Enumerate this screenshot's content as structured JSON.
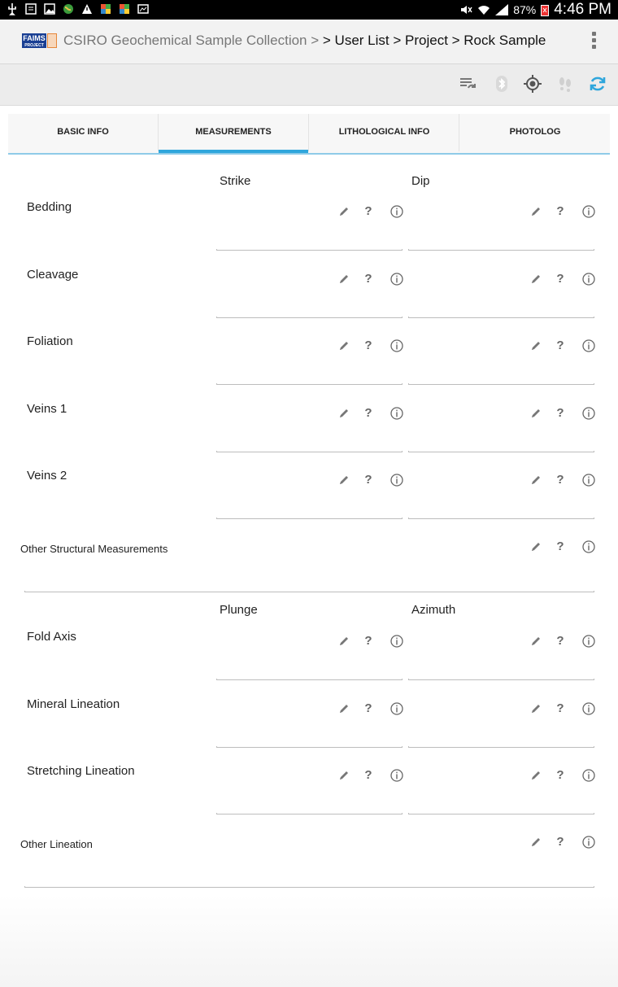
{
  "status_bar": {
    "time": "4:46 PM",
    "battery": "87%"
  },
  "action_bar": {
    "logo_text": "FAIMS",
    "logo_sub": "PROJECT",
    "breadcrumb_prefix": "CSIRO Geochemical Sample Collection >",
    "breadcrumb_path": "> User List > Project > Rock Sample"
  },
  "toolbar": {
    "icons": [
      "sync-settings-icon",
      "bluetooth-icon",
      "gps-target-icon",
      "footsteps-icon",
      "refresh-icon"
    ]
  },
  "tabs": [
    {
      "label": "BASIC INFO",
      "active": false
    },
    {
      "label": "MEASUREMENTS",
      "active": true
    },
    {
      "label": "LITHOLOGICAL INFO",
      "active": false
    },
    {
      "label": "PHOTOLOG",
      "active": false
    }
  ],
  "sections": {
    "structural": {
      "col1": "Strike",
      "col2": "Dip",
      "rows": [
        "Bedding",
        "Cleavage",
        "Foliation",
        "Veins 1",
        "Veins 2"
      ],
      "other_label": "Other Structural Measurements"
    },
    "lineation": {
      "col1": "Plunge",
      "col2": "Azimuth",
      "rows": [
        "Fold Axis",
        "Mineral Lineation",
        "Stretching Lineation"
      ],
      "other_label": "Other Lineation"
    }
  },
  "field_actions": {
    "help_glyph": "?"
  },
  "colors": {
    "accent": "#2fa6dc",
    "tab_underline": "#8fcbe8",
    "logo_blue": "#1a3f93"
  }
}
